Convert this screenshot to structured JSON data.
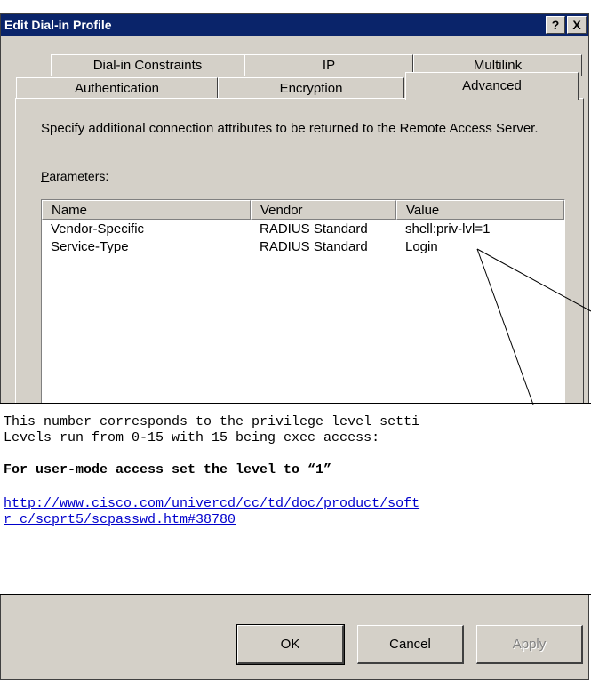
{
  "window": {
    "title": "Edit Dial-in Profile",
    "help_label": "?",
    "close_label": "X"
  },
  "tabs": {
    "back_row": [
      "Dial-in Constraints",
      "IP",
      "Multilink"
    ],
    "front_row": [
      "Authentication",
      "Encryption",
      "Advanced"
    ],
    "active": "Advanced"
  },
  "panel": {
    "description": "Specify additional connection attributes to be returned to the Remote Access Server.",
    "parameters_label": "Parameters:"
  },
  "table": {
    "columns": [
      "Name",
      "Vendor",
      "Value"
    ],
    "rows": [
      [
        "Vendor-Specific",
        "RADIUS Standard",
        "shell:priv-lvl=1"
      ],
      [
        "Service-Type",
        "RADIUS Standard",
        "Login"
      ]
    ]
  },
  "callout": {
    "line1": "This number corresponds to the privilege level setti",
    "line2": "Levels run from 0-15 with 15 being exec access:",
    "bold_line": "For user-mode access set the level to “1”",
    "link_line1": "http://www.cisco.com/univercd/cc/td/doc/product/soft",
    "link_line2": "r c/scprt5/scpasswd.htm#38780"
  },
  "buttons": {
    "ok": "OK",
    "cancel": "Cancel",
    "apply": "Apply"
  },
  "colors": {
    "titlebar": "#0a246a",
    "face": "#d4d0c8",
    "link": "#0000cc"
  }
}
